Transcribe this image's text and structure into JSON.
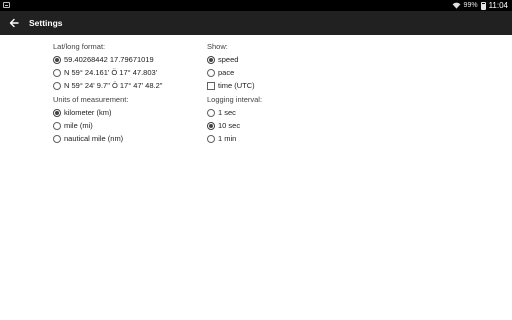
{
  "status_bar": {
    "battery_text": "99%",
    "time": "11:04",
    "icons": [
      "notification-icon",
      "wifi-icon",
      "battery-icon"
    ]
  },
  "app_bar": {
    "back_icon": "arrow-back-icon",
    "title": "Settings"
  },
  "latlong": {
    "label": "Lat/long format:",
    "options": [
      {
        "label": "59.40268442 17.79671019",
        "checked": true
      },
      {
        "label": "N 59° 24.161' Ö 17° 47.803'",
        "checked": false
      },
      {
        "label": "N 59° 24' 9.7\" Ö 17° 47' 48.2\"",
        "checked": false
      }
    ]
  },
  "units": {
    "label": "Units of measurement:",
    "options": [
      {
        "label": "kilometer (km)",
        "checked": true
      },
      {
        "label": "mile (mi)",
        "checked": false
      },
      {
        "label": "nautical mile (nm)",
        "checked": false
      }
    ]
  },
  "show": {
    "label": "Show:",
    "options": [
      {
        "label": "speed",
        "type": "radio",
        "checked": true
      },
      {
        "label": "pace",
        "type": "radio",
        "checked": false
      },
      {
        "label": "time (UTC)",
        "type": "checkbox",
        "checked": false
      }
    ]
  },
  "logging": {
    "label": "Logging interval:",
    "options": [
      {
        "label": "1 sec",
        "checked": false
      },
      {
        "label": "10 sec",
        "checked": true
      },
      {
        "label": "1 min",
        "checked": false
      }
    ]
  },
  "colors": {
    "app_bar": "#212121",
    "status_bar": "#000000",
    "background": "#ffffff"
  }
}
